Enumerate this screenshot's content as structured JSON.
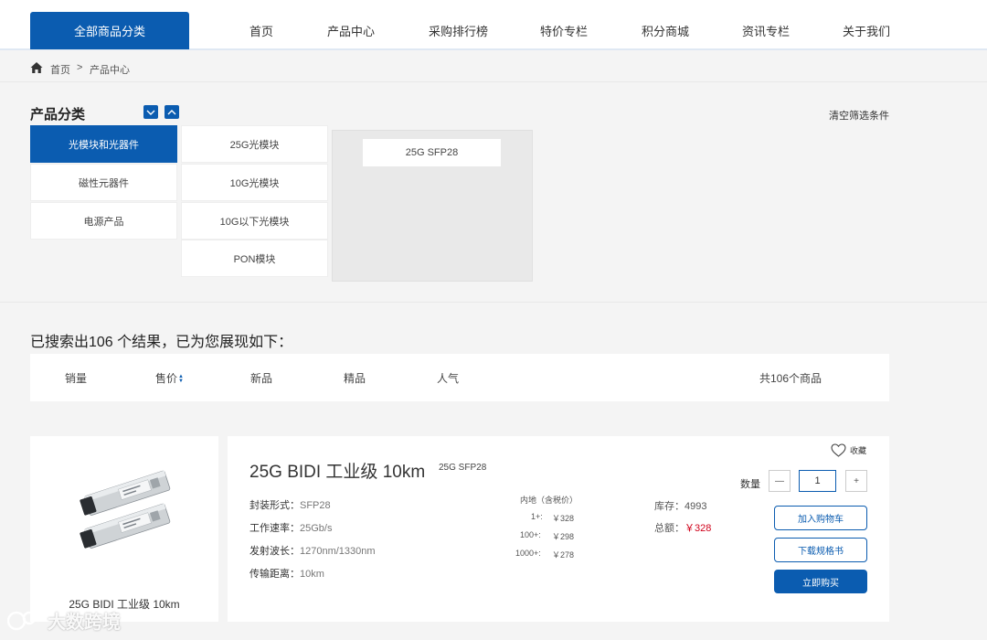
{
  "header": {
    "all_categories": "全部商品分类",
    "nav": [
      "首页",
      "产品中心",
      "采购排行榜",
      "特价专栏",
      "积分商城",
      "资讯专栏",
      "关于我们"
    ]
  },
  "breadcrumb": {
    "home": "首页",
    "separator": ">",
    "current": "产品中心"
  },
  "category_panel": {
    "title": "产品分类",
    "clear_filters": "清空筛选条件",
    "level1": [
      "光模块和光器件",
      "磁性元器件",
      "电源产品"
    ],
    "level1_selected": "光模块和光器件",
    "level2": [
      "25G光模块",
      "10G光模块",
      "10G以下光模块",
      "PON模块"
    ],
    "level3": [
      "25G SFP28"
    ]
  },
  "results": {
    "summary": "已搜索出106 个结果，已为您展现如下：",
    "sort_options": [
      "销量",
      "售价",
      "新品",
      "精品",
      "人气"
    ],
    "total": "共106个商品"
  },
  "product": {
    "image_caption": "25G BIDI 工业级 10km",
    "name": "25G BIDI 工业级 10km",
    "model": "25G SFP28",
    "specs": [
      {
        "label": "封装形式：",
        "value": "SFP28"
      },
      {
        "label": "工作速率：",
        "value": "25Gb/s"
      },
      {
        "label": "发射波长：",
        "value": "1270nm/1330nm"
      },
      {
        "label": "传输距离：",
        "value": "10km"
      }
    ],
    "price_header": "内地（含税价）",
    "price_tiers": [
      {
        "qty": "1+:",
        "price": "￥328"
      },
      {
        "qty": "100+:",
        "price": "￥298"
      },
      {
        "qty": "1000+:",
        "price": "￥278"
      }
    ],
    "stock_label": "库存：",
    "stock_value": "4993",
    "total_label": "总额：",
    "total_value": "￥328",
    "favorite": "收藏",
    "qty_label": "数量",
    "qty_value": "1",
    "minus": "—",
    "plus": "+",
    "add_to_cart": "加入购物车",
    "download_spec": "下载规格书",
    "buy_now": "立即购买"
  },
  "watermark": "大数跨境",
  "colors": {
    "accent": "#0b5cb0",
    "price": "#d0021b"
  }
}
